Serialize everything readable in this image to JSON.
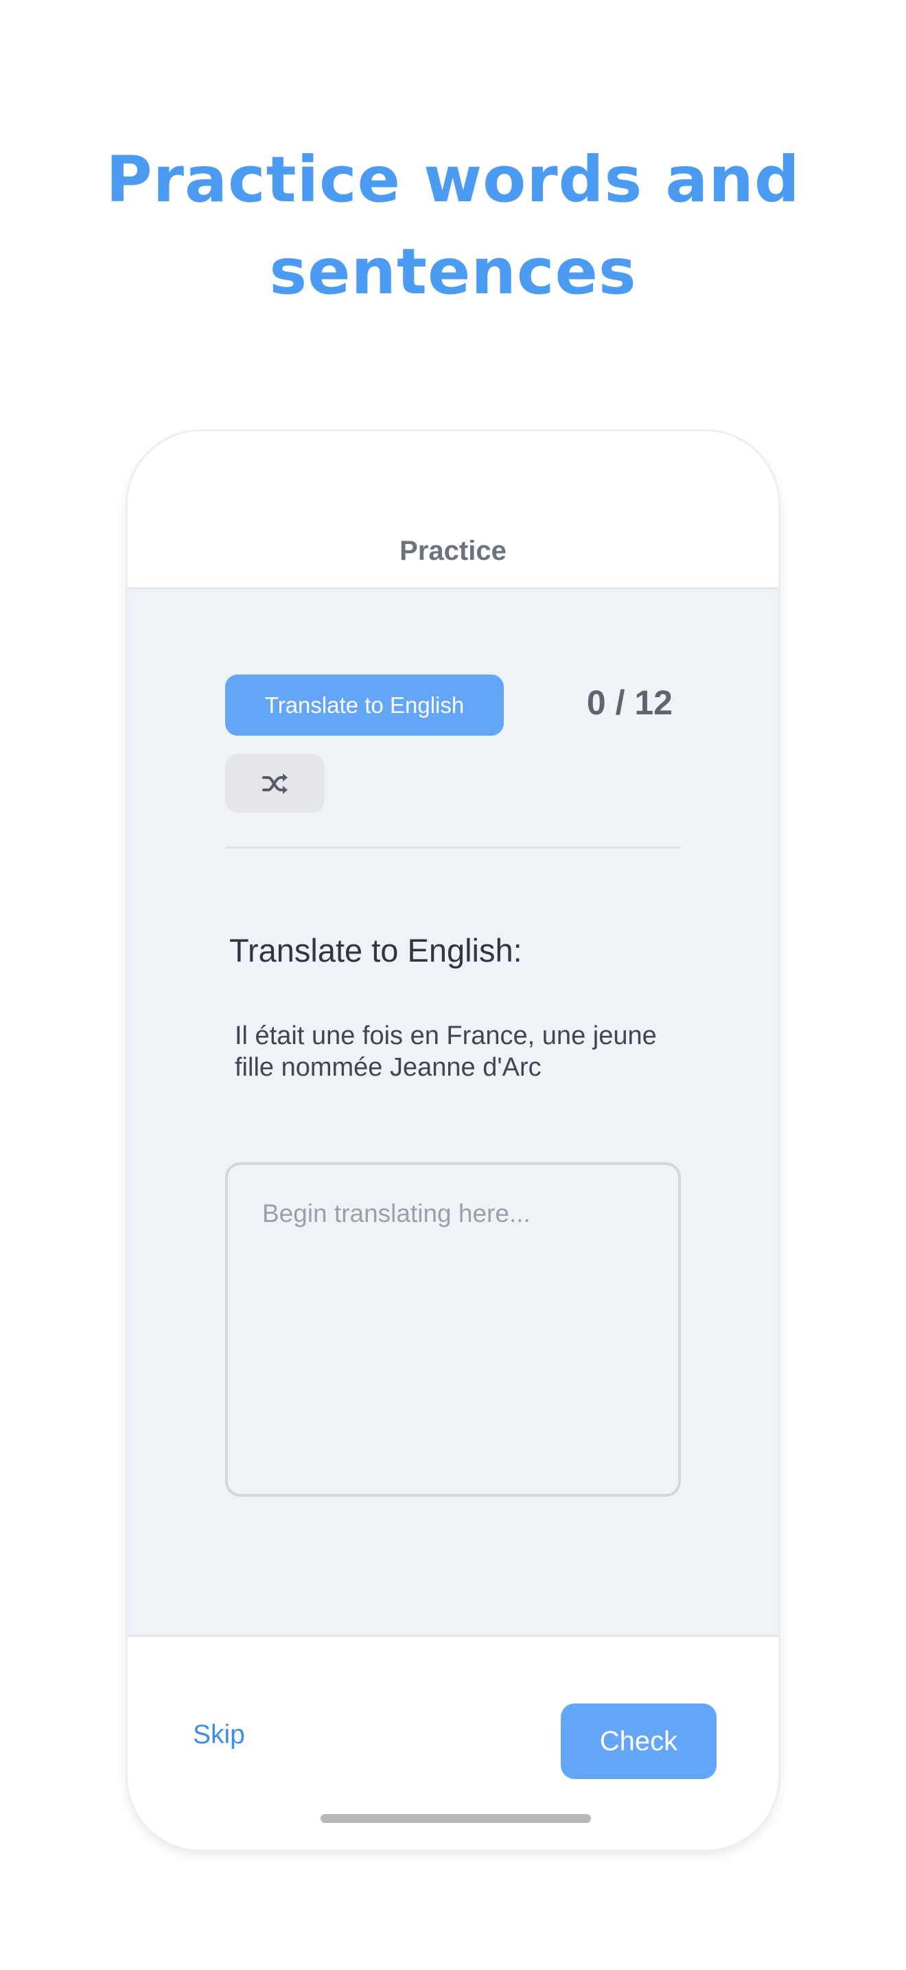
{
  "headline": {
    "line1": "Practice words and",
    "line2": "sentences"
  },
  "phone": {
    "nav": {
      "title": "Practice"
    },
    "toolbar": {
      "mode_label": "Translate to English",
      "progress": "0 / 12",
      "shuffle_icon": "shuffle-icon"
    },
    "exercise": {
      "heading": "Translate to English:",
      "sentence": "Il était une fois en France, une jeune fille nommée Jeanne d'Arc",
      "answer_value": "",
      "answer_placeholder": "Begin translating here..."
    },
    "footer": {
      "skip_label": "Skip",
      "check_label": "Check"
    }
  },
  "colors": {
    "accent": "#4c9bf3",
    "button": "#63a5f7",
    "content_bg": "#eff3f8"
  }
}
